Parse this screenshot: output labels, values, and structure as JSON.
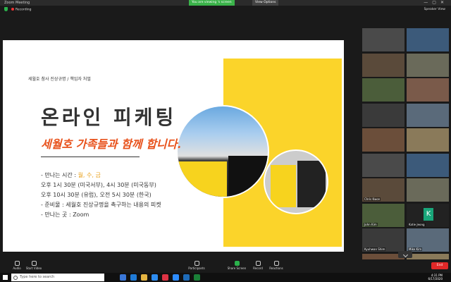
{
  "window": {
    "app_title": "Zoom Meeting",
    "banner": "You are viewing 's screen",
    "view_options": "View Options",
    "controls": [
      "—",
      "▢",
      "✕"
    ]
  },
  "topbar": {
    "recording": "Recording",
    "speaker_view": "Speaker View"
  },
  "slide": {
    "subtitle": "세월호 참사 진상규명 / 책임자 처벌",
    "title": "온라인 피케팅",
    "tagline": "세월호 가족들과 함께 합니다.",
    "details": [
      {
        "prefix": "- 만나는 시간 : ",
        "highlight": "월, 수, 금"
      },
      {
        "prefix": "오후 1시 30분 (미국서부), 4시 30분 (미국동부)",
        "highlight": ""
      },
      {
        "prefix": "오후 10시 30분 (유럽), 오전 5시 30분 (한국)",
        "highlight": ""
      },
      {
        "prefix": "- 준비물 : 세월호 진상규명을 촉구하는 내용의 피켓",
        "highlight": ""
      },
      {
        "prefix": "- 만나는 곳 : Zoom",
        "highlight": ""
      }
    ]
  },
  "gallery": [
    {
      "name": ""
    },
    {
      "name": ""
    },
    {
      "name": ""
    },
    {
      "name": ""
    },
    {
      "name": ""
    },
    {
      "name": ""
    },
    {
      "name": ""
    },
    {
      "name": ""
    },
    {
      "name": ""
    },
    {
      "name": ""
    },
    {
      "name": ""
    },
    {
      "name": ""
    },
    {
      "name": "Chris Kwon"
    },
    {
      "name": ""
    },
    {
      "name": "John Kim"
    },
    {
      "name": "Katie Jeong"
    },
    {
      "name": "Kyuhwan Shim"
    },
    {
      "name": "Mike Kim"
    },
    {
      "name": "Vincent"
    },
    {
      "name": ""
    }
  ],
  "toolbar": {
    "audio": "Audio",
    "video": "Start Video",
    "participants": "Participants",
    "share": "Share Screen",
    "record": "Record",
    "reactions": "Reactions",
    "end": "End"
  },
  "taskbar": {
    "search_placeholder": "Type here to search",
    "time": "4:31 PM",
    "date": "6/17/2020"
  }
}
